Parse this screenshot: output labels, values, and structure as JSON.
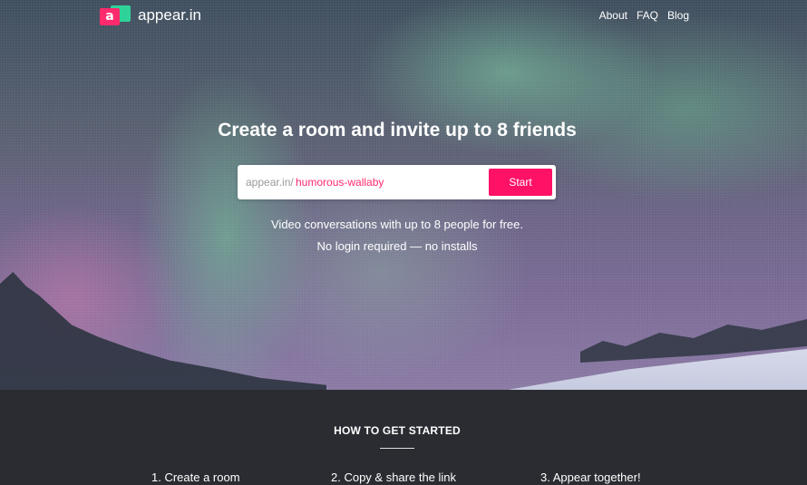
{
  "brand": {
    "name": "appear.in",
    "logo_letter": "a",
    "colors": {
      "pink": "#ff2a6d",
      "green": "#2fd39a"
    }
  },
  "nav": {
    "items": [
      "About",
      "FAQ",
      "Blog"
    ]
  },
  "hero": {
    "headline": "Create a room and invite up to 8 friends",
    "room_prefix": "appear.in/",
    "room_name": "humorous-wallaby",
    "start_label": "Start",
    "tagline_1": "Video conversations with up to 8 people for free.",
    "tagline_2": "No login required — no installs"
  },
  "how_to": {
    "title": "HOW TO GET STARTED",
    "steps": [
      "1. Create a room",
      "2. Copy & share the link",
      "3. Appear together!"
    ]
  }
}
